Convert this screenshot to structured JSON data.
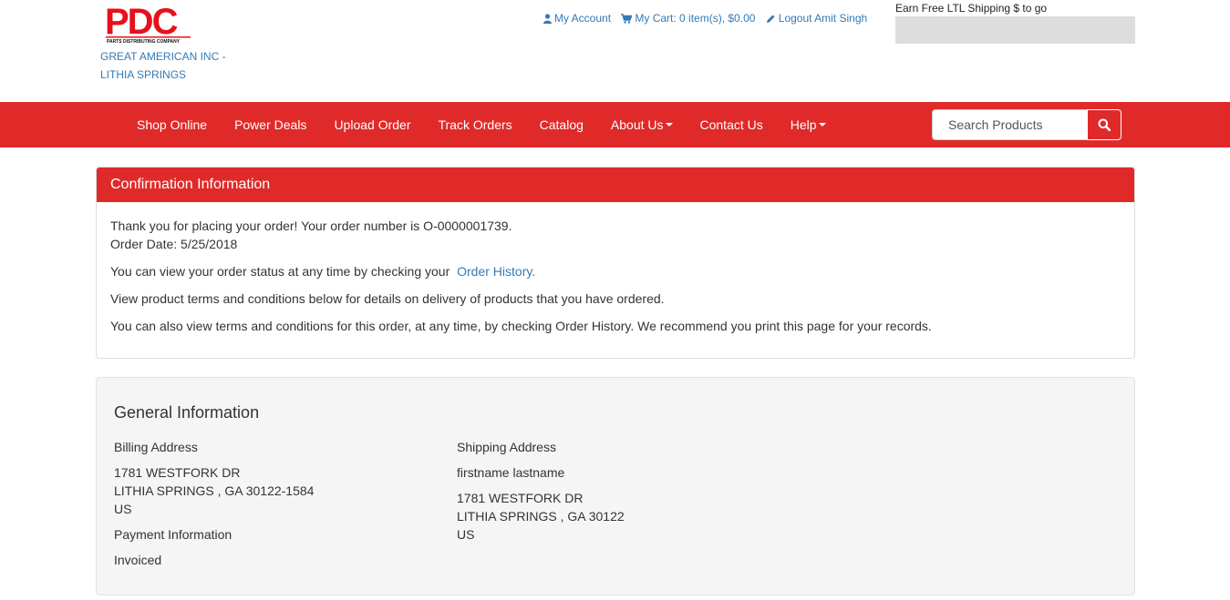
{
  "header": {
    "logo": {
      "text": "PDC",
      "subtext": "PARTS DISTRIBUTING COMPANY",
      "color": "#e8101a"
    },
    "company_line1": "GREAT AMERICAN INC -",
    "company_line2": "LITHIA SPRINGS",
    "links": {
      "account": "My Account",
      "cart": "My Cart: 0 item(s), $0.00",
      "logout": "Logout Amit Singh"
    },
    "shipping_label": "Earn Free LTL Shipping $ to go",
    "shipping_progress": 0
  },
  "nav": {
    "items": [
      {
        "label": "Shop Online",
        "dropdown": false
      },
      {
        "label": "Power Deals",
        "dropdown": false
      },
      {
        "label": "Upload Order",
        "dropdown": false
      },
      {
        "label": "Track Orders",
        "dropdown": false
      },
      {
        "label": "Catalog",
        "dropdown": false
      },
      {
        "label": "About Us",
        "dropdown": true
      },
      {
        "label": "Contact Us",
        "dropdown": false
      },
      {
        "label": "Help",
        "dropdown": true
      }
    ],
    "search_placeholder": "Search Products"
  },
  "confirmation": {
    "title": "Confirmation Information",
    "line1": "Thank you for placing your order! Your order number is O-0000001739.",
    "order_date": "Order Date: 5/25/2018",
    "status_text": "You can view your order status at any time by checking your",
    "history_link": "Order History.",
    "terms_text": "View product terms and conditions below for details on delivery of products that you have ordered.",
    "records_text": "You can also view terms and conditions for this order, at any time, by checking Order History. We recommend you print this page for your records."
  },
  "general": {
    "title": "General Information",
    "billing_label": "Billing Address",
    "billing_street": "1781 WESTFORK DR",
    "billing_city": "LITHIA SPRINGS , GA  30122-1584",
    "billing_country": "US",
    "payment_label": "Payment Information",
    "payment_value": "Invoiced",
    "shipping_label": "Shipping Address",
    "shipping_name": "firstname  lastname",
    "shipping_street": "1781 WESTFORK DR",
    "shipping_city": "LITHIA SPRINGS , GA  30122",
    "shipping_country": "US"
  },
  "colors": {
    "brand_red": "#e02a2a",
    "link_blue": "#337ab7"
  }
}
